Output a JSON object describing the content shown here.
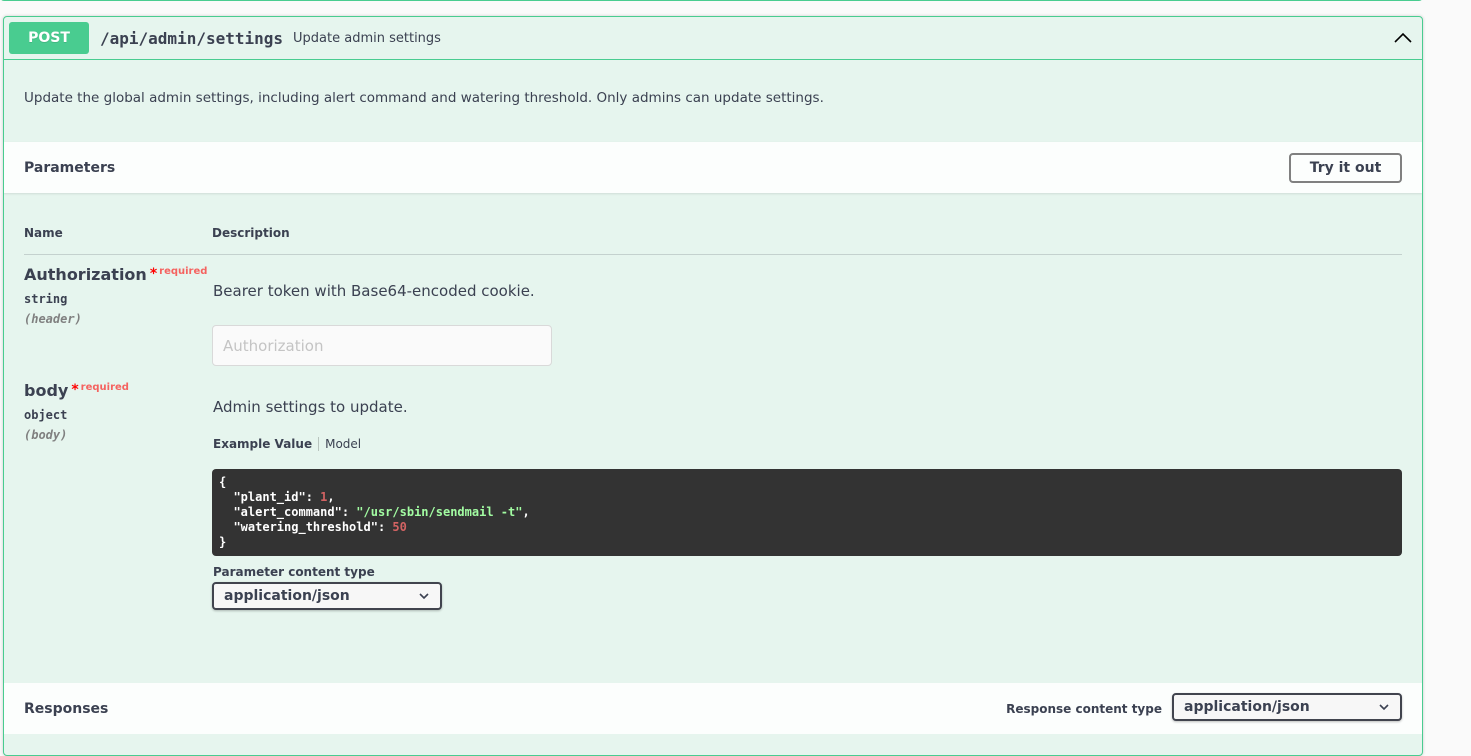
{
  "operation": {
    "method": "POST",
    "path": "/api/admin/settings",
    "summary": "Update admin settings",
    "description": "Update the global admin settings, including alert command and watering threshold. Only admins can update settings.",
    "collapse_icon": "chevron-up-icon",
    "colors": {
      "accent": "#49cc90",
      "background": "#e6f5ee"
    }
  },
  "parameters": {
    "title": "Parameters",
    "try_button": "Try it out",
    "columns": {
      "name": "Name",
      "description": "Description"
    },
    "items": [
      {
        "name": "Authorization",
        "required_star": "*",
        "required_label": "required",
        "type": "string",
        "in": "(header)",
        "description": "Bearer token with Base64-encoded cookie.",
        "input_placeholder": "Authorization",
        "input_value": ""
      },
      {
        "name": "body",
        "required_star": "*",
        "required_label": "required",
        "type": "object",
        "in": "(body)",
        "description": "Admin settings to update.",
        "tabs": {
          "active": "Example Value",
          "other": "Model"
        },
        "example": {
          "open": "{",
          "close": "}",
          "lines": [
            {
              "key": "\"plant_id\"",
              "value": "1",
              "kind": "num",
              "trail": ","
            },
            {
              "key": "\"alert_command\"",
              "value": "\"/usr/sbin/sendmail -t\"",
              "kind": "str",
              "trail": ","
            },
            {
              "key": "\"watering_threshold\"",
              "value": "50",
              "kind": "num",
              "trail": ""
            }
          ]
        },
        "content_type_label": "Parameter content type",
        "content_type_value": "application/json"
      }
    ]
  },
  "responses": {
    "title": "Responses",
    "content_type_label": "Response content type",
    "content_type_value": "application/json"
  }
}
